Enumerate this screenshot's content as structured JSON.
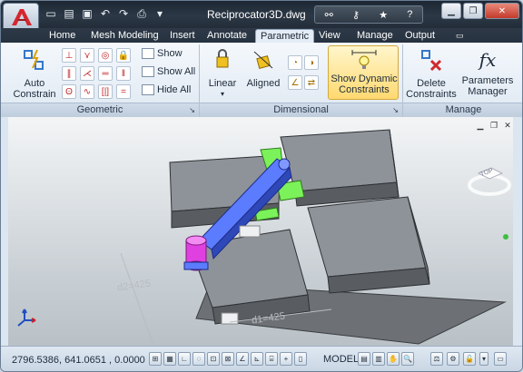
{
  "window": {
    "title": "Reciprocator3D.dwg"
  },
  "quick_access": {
    "icons": [
      "new-file-icon",
      "open-folder-icon",
      "save-icon",
      "undo-icon",
      "redo-icon",
      "print-icon",
      "dropdown-icon"
    ]
  },
  "infocenter": {
    "icons": [
      "binoculars-icon",
      "key-icon",
      "star-icon",
      "help-icon"
    ]
  },
  "tabs": [
    {
      "label": "Home"
    },
    {
      "label": "Mesh Modeling"
    },
    {
      "label": "Insert"
    },
    {
      "label": "Annotate"
    },
    {
      "label": "Parametric",
      "active": true
    },
    {
      "label": "View"
    },
    {
      "label": "Manage"
    },
    {
      "label": "Output"
    }
  ],
  "ribbon": {
    "geometric": {
      "panel_label": "Geometric",
      "auto_constrain_label": "Auto\nConstrain",
      "show_label": "Show",
      "show_all_label": "Show All",
      "hide_all_label": "Hide All"
    },
    "dimensional": {
      "panel_label": "Dimensional",
      "linear_label": "Linear",
      "aligned_label": "Aligned",
      "show_dynamic_label": "Show Dynamic\nConstraints"
    },
    "manage": {
      "panel_label": "Manage",
      "delete_label": "Delete\nConstraints",
      "parameters_label": "Parameters\nManager"
    }
  },
  "drawing": {
    "dim1": "d1=425",
    "dim2": "d2=425",
    "viewcube_label": "TOP"
  },
  "statusbar": {
    "coords": "2796.5386, 641.0651 , 0.0000",
    "model_label": "MODEL"
  },
  "colors": {
    "title_bg": "#222d39",
    "highlight": "#ffd970",
    "block_top": "#8e9399",
    "arm": "#5c7cff",
    "cylinder": "#e040e0",
    "green_pad": "#7cf25a"
  }
}
